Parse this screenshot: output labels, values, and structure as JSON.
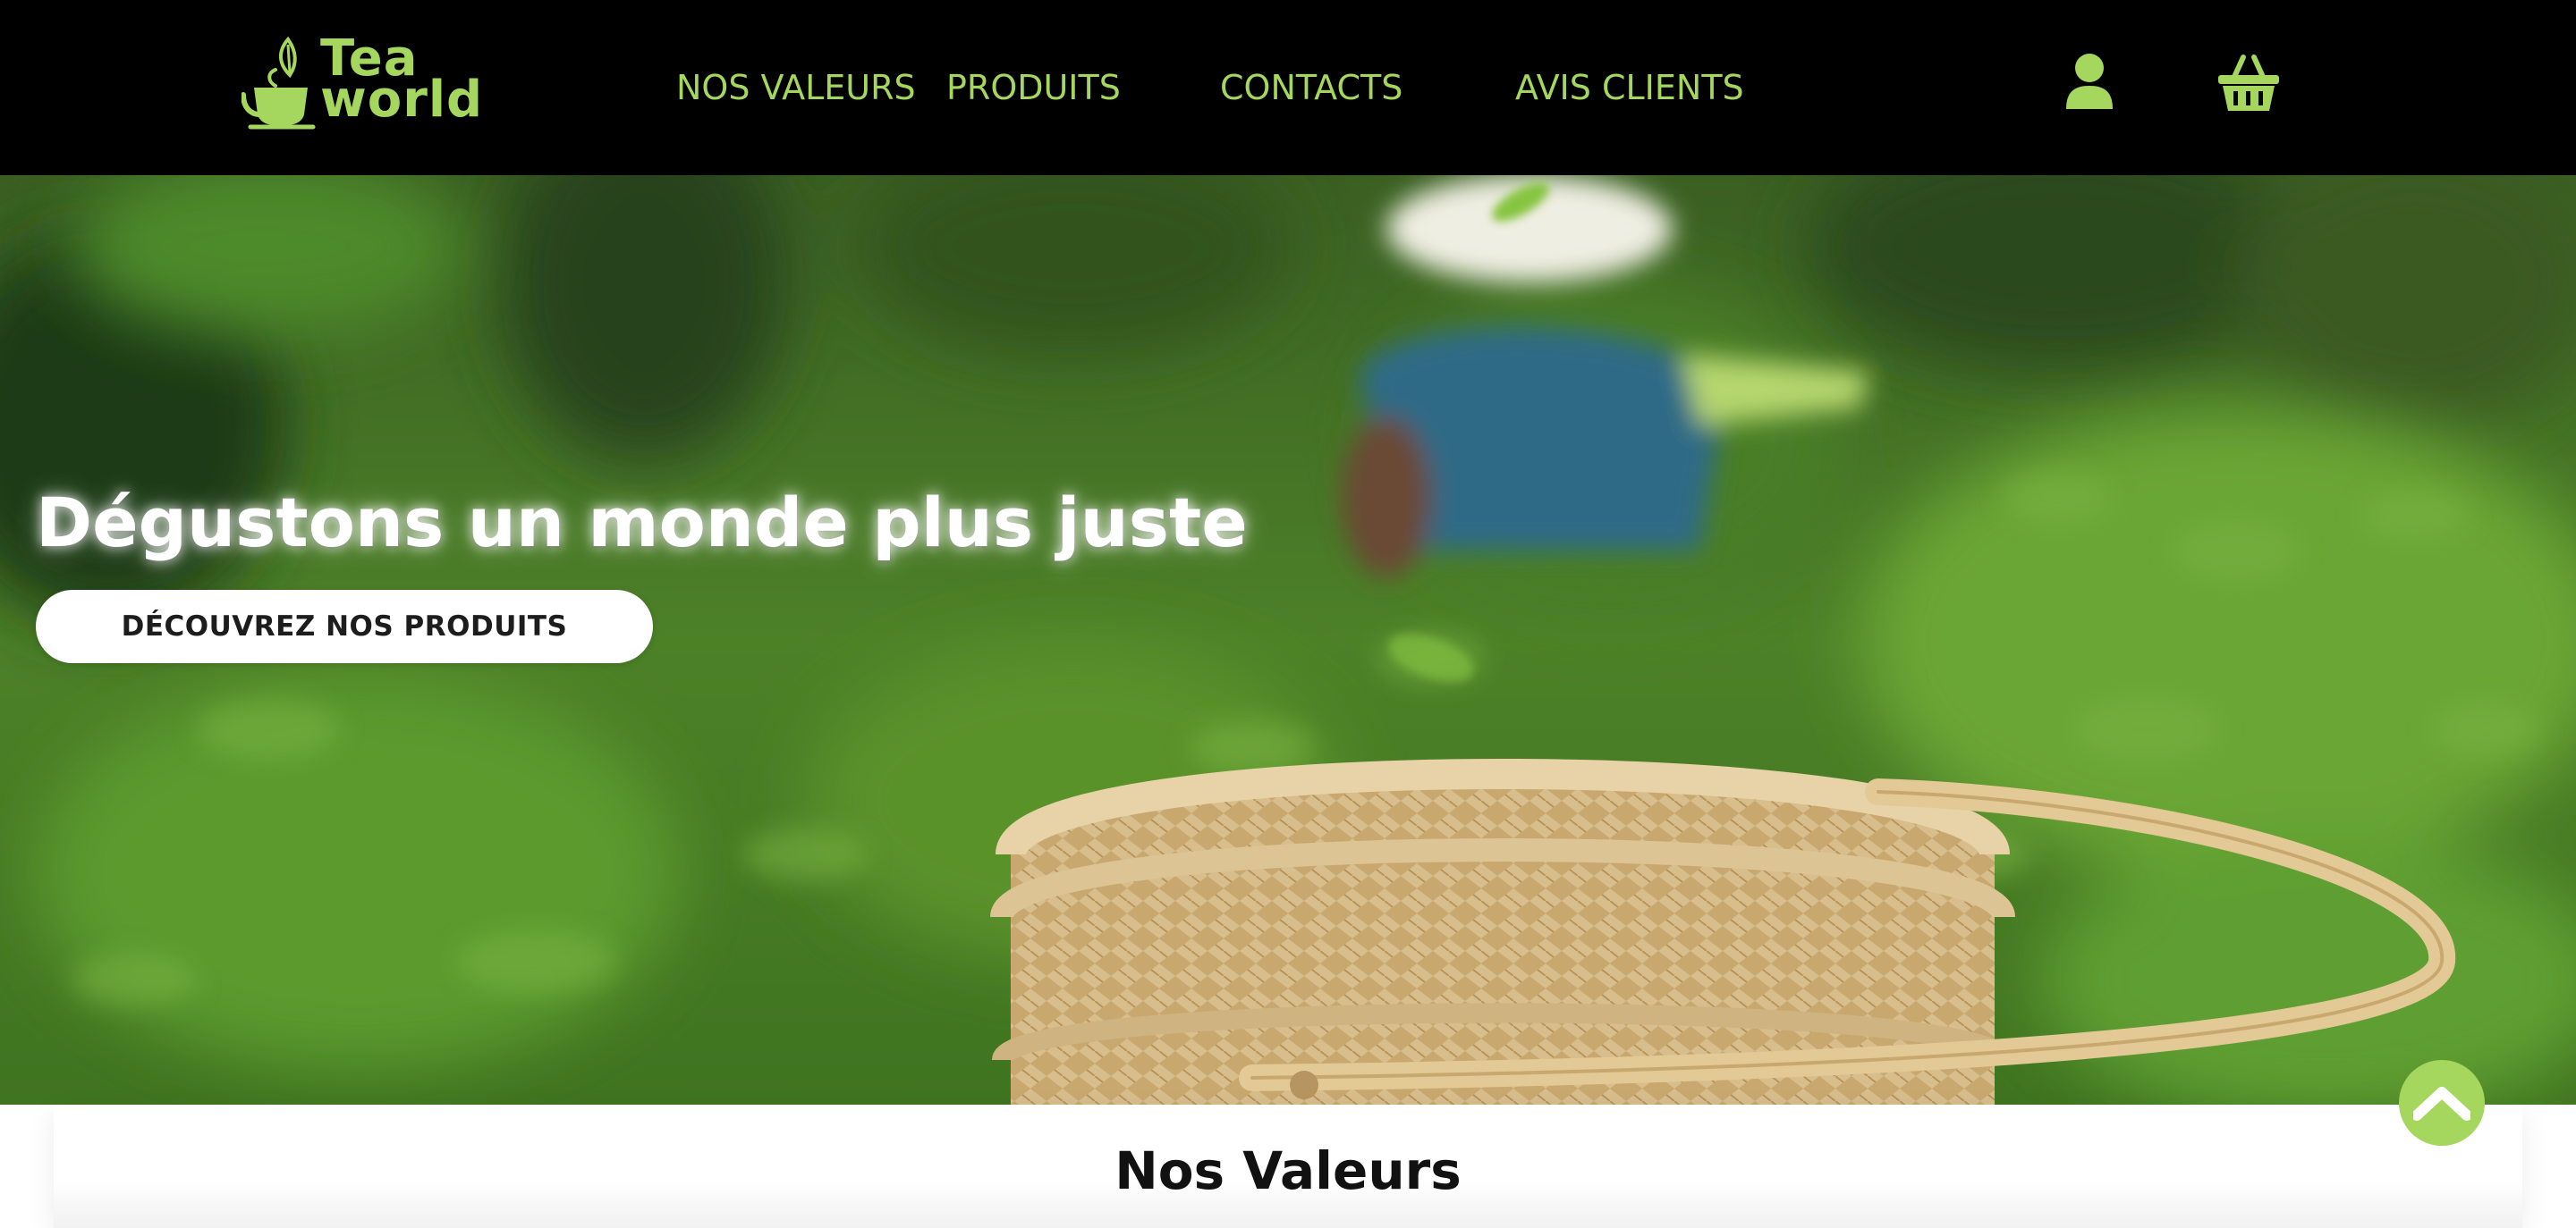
{
  "brand": {
    "logo_text_line1": "Tea",
    "logo_text_line2": "world",
    "accent_color": "#a5d65e",
    "header_bg": "#000000"
  },
  "nav": {
    "items": [
      {
        "label": "NOS VALEURS"
      },
      {
        "label": "PRODUITS"
      },
      {
        "label": "CONTACTS"
      },
      {
        "label": "AVIS CLIENTS"
      }
    ]
  },
  "header_icons": {
    "user": "user-icon",
    "cart": "basket-icon"
  },
  "hero": {
    "title": "Dégustons un monde plus juste",
    "cta_label": "DÉCOUVREZ NOS PRODUITS",
    "background": "tea-plantation-photo"
  },
  "section": {
    "title": "Nos Valeurs"
  },
  "scroll_top": {
    "icon": "chevron-up-icon"
  }
}
